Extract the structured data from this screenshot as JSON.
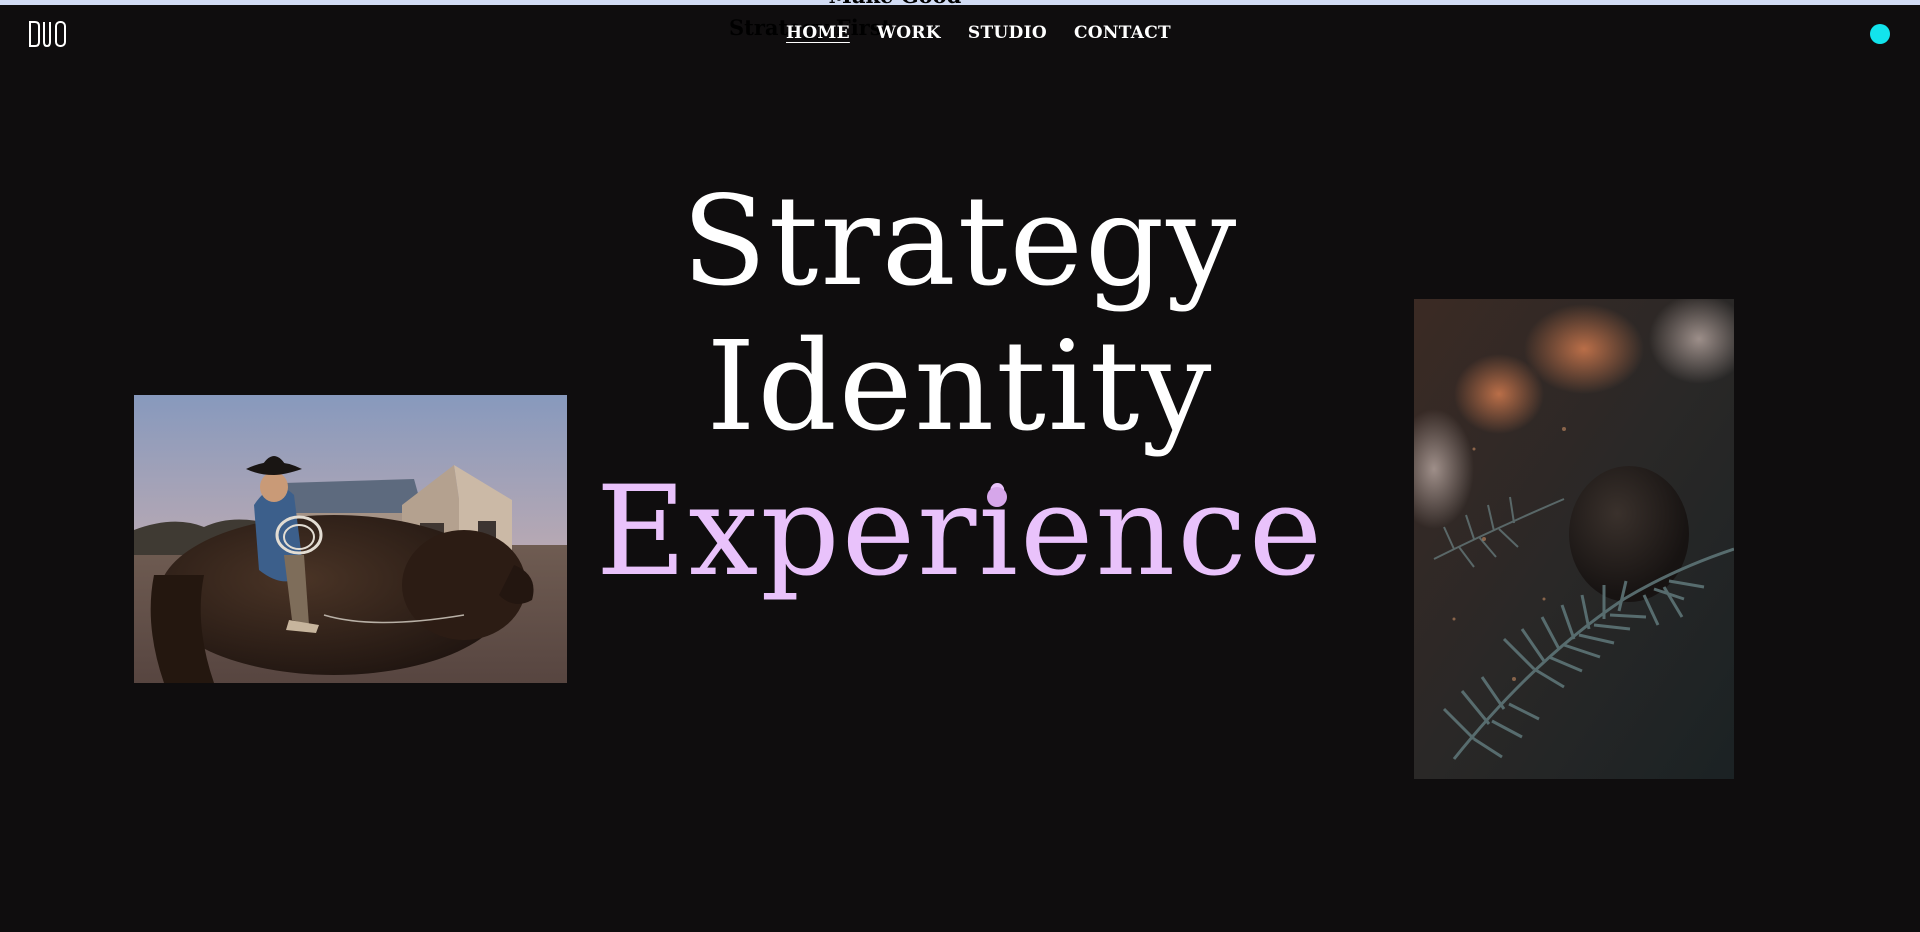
{
  "site": {
    "logo_text": "DUO",
    "ghost_heading": {
      "line1": "Make Good",
      "line2": "Strategy First"
    }
  },
  "nav": {
    "items": [
      {
        "label": "HOME",
        "active": true
      },
      {
        "label": "WORK",
        "active": false
      },
      {
        "label": "STUDIO",
        "active": false
      },
      {
        "label": "CONTACT",
        "active": false
      }
    ]
  },
  "hero": {
    "words": [
      "Strategy",
      "Identity",
      "Experience"
    ],
    "accent_color": "#e9c2fb"
  },
  "images": {
    "left": {
      "subject": "cowboy-riding-bison-photo"
    },
    "right": {
      "subject": "frosted-pine-branch-photo"
    }
  },
  "colors": {
    "background": "#0f0d0e",
    "status_dot": "#12e3ec",
    "top_strip": "#d2dcf4"
  }
}
